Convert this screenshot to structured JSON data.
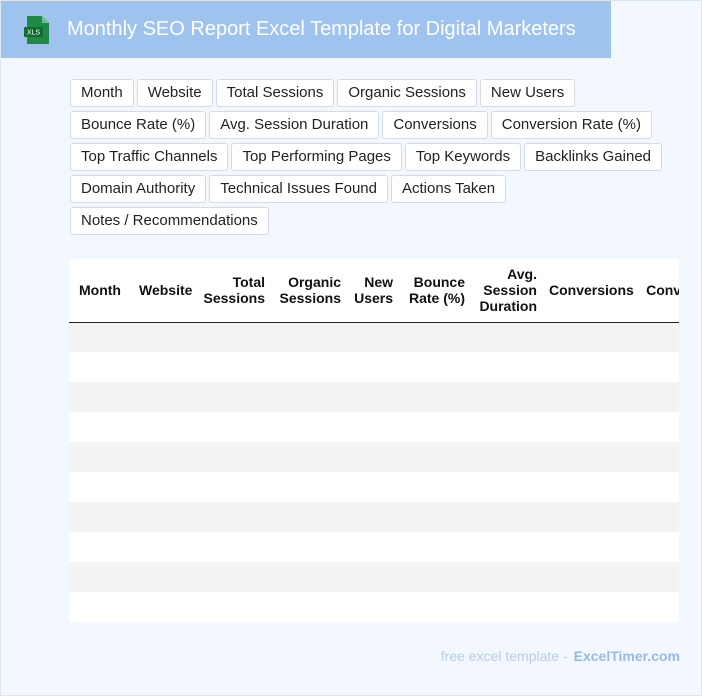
{
  "header": {
    "icon": "xls-file-icon",
    "icon_label": "XLS",
    "title": "Monthly SEO Report Excel Template for Digital Marketers",
    "accent_color": "#9ec3ee",
    "icon_color": "#1e8a45"
  },
  "chips": [
    "Month",
    "Website",
    "Total Sessions",
    "Organic Sessions",
    "New Users",
    "Bounce Rate (%)",
    "Avg. Session Duration",
    "Conversions",
    "Conversion Rate (%)",
    "Top Traffic Channels",
    "Top Performing Pages",
    "Top Keywords",
    "Backlinks Gained",
    "Domain Authority",
    "Technical Issues Found",
    "Actions Taken",
    "Notes / Recommendations"
  ],
  "table": {
    "columns": [
      "Month",
      "Website",
      "Total Sessions",
      "Organic Sessions",
      "New Users",
      "Bounce Rate (%)",
      "Avg. Session Duration",
      "Conversions",
      "Conversion Rate (%)"
    ],
    "row_count": 10
  },
  "footer": {
    "prefix": "free excel template -",
    "brand": "ExcelTimer.com"
  }
}
